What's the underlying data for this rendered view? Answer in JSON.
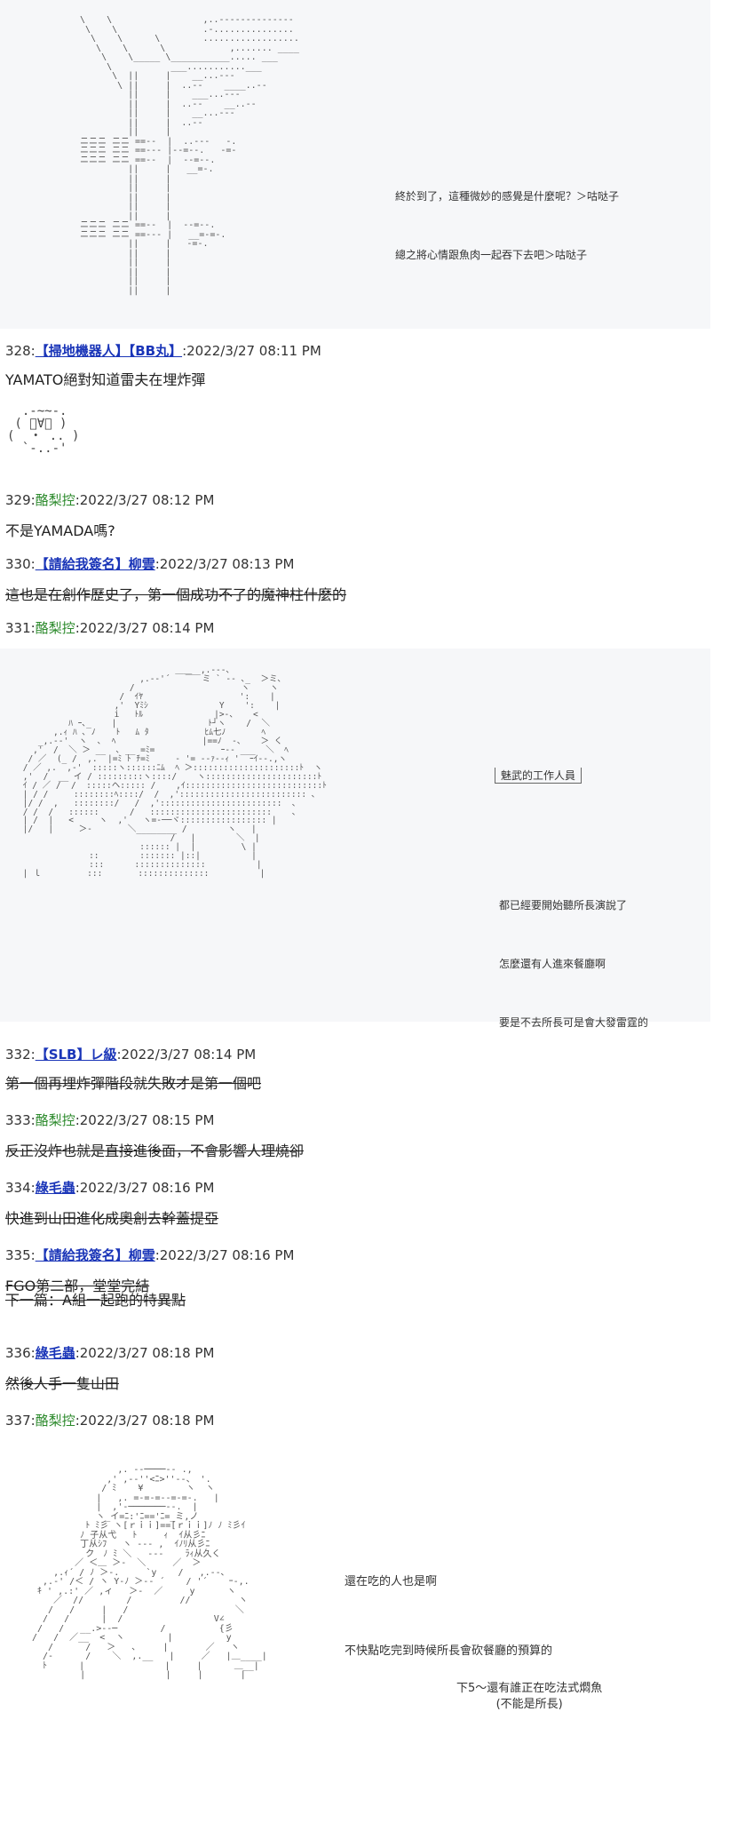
{
  "scene1": {
    "dialogue": [
      "終於到了，這種微妙的感覺是什麼呢？＞咕哒子",
      "總之將心情跟魚肉一起吞下去吧＞咕哒子"
    ]
  },
  "posts": [
    {
      "num": "328:",
      "name": "【掃地機器人】【BB丸】",
      "date": ":2022/3/27 08:11 PM",
      "body": "YAMATO絕對知道雷夫在埋炸彈",
      "strike": false
    },
    {
      "num": "329:",
      "name": "酪梨控",
      "date": ":2022/3/27 08:12 PM",
      "body": "不是YAMADA嗎?",
      "strike": false
    },
    {
      "num": "330:",
      "name": "【請給我簽名】柳雲",
      "date": ":2022/3/27 08:13 PM",
      "body": "這也是在創作歷史了，第一個成功不了的魔神柱什麼的",
      "strike": true
    },
    {
      "num": "331:",
      "name": "酪梨控",
      "date": ":2022/3/27 08:14 PM",
      "body": "",
      "strike": false
    },
    {
      "num": "332:",
      "name": "【SLB】レ級",
      "date": ":2022/3/27 08:14 PM",
      "body": "第一個再埋炸彈階段就失敗才是第一個吧",
      "strike": true
    },
    {
      "num": "333:",
      "name": "酪梨控",
      "date": ":2022/3/27 08:15 PM",
      "body": "反正沒炸也就是直接進後面，不會影響人理燒卻",
      "strike": true
    },
    {
      "num": "334:",
      "name": "綠毛蟲",
      "date": ":2022/3/27 08:16 PM",
      "body": "快進到山田進化成奧創去幹蓋提亞",
      "strike": true
    },
    {
      "num": "335:",
      "name": "【請給我簽名】柳雲",
      "date": ":2022/3/27 08:16 PM",
      "body": "FGO第二部，堂堂完結\n下一篇：A組一起跑的特異點",
      "strike": true
    },
    {
      "num": "336:",
      "name": "綠毛蟲",
      "date": ":2022/3/27 08:18 PM",
      "body": "然後人手一隻山田",
      "strike": true
    },
    {
      "num": "337:",
      "name": "酪梨控",
      "date": ":2022/3/27 08:18 PM",
      "body": "",
      "strike": false
    }
  ],
  "scene2": {
    "label": "魅武的工作人員",
    "dialogue": [
      "都已經要開始聽所長演說了",
      "怎麼還有人進來餐廳啊",
      "要是不去所長可是會大發雷霆的"
    ]
  },
  "scene3": {
    "dialogue": [
      "還在吃的人也是啊",
      "不快點吃完到時候所長會砍餐廳的預算的"
    ],
    "note": "下5～還有誰正在吃法式燜魚\n(不能是所長)"
  }
}
